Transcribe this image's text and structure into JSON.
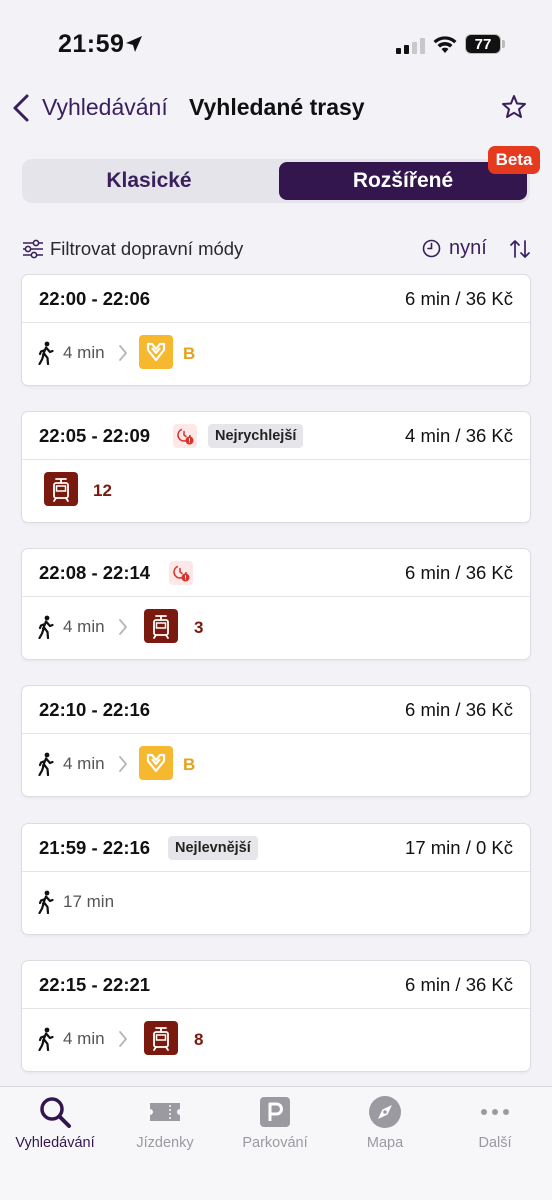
{
  "status_bar": {
    "time": "21:59",
    "battery": "77"
  },
  "nav": {
    "back_label": "Vyhledávání",
    "title": "Vyhledané trasy"
  },
  "segment": {
    "classic_label": "Klasické",
    "extended_label": "Rozšířené",
    "badge": "Beta",
    "selected": "extended"
  },
  "filter": {
    "label": "Filtrovat dopravní módy",
    "time_label": "nyní"
  },
  "routes": [
    {
      "time": "22:00 - 22:06",
      "info": "6 min / 36 Kč",
      "walk": "4 min",
      "line": "B",
      "mode": "metro"
    },
    {
      "time": "22:05 - 22:09",
      "info": "4 min / 36 Kč",
      "tag": "Nejrychlejší",
      "line": "12",
      "mode": "tram"
    },
    {
      "time": "22:08 - 22:14",
      "info": "6 min / 36 Kč",
      "walk": "4 min",
      "line": "3",
      "mode": "tram"
    },
    {
      "time": "22:10 - 22:16",
      "info": "6 min / 36 Kč",
      "walk": "4 min",
      "line": "B",
      "mode": "metro"
    },
    {
      "time": "21:59 - 22:16",
      "info": "17 min / 0 Kč",
      "tag": "Nejlevnější",
      "walk": "17 min"
    },
    {
      "time": "22:15 - 22:21",
      "info": "6 min / 36 Kč",
      "walk": "4 min",
      "line": "8",
      "mode": "tram"
    }
  ],
  "tabs": [
    {
      "label": "Vyhledávání",
      "icon": "search-icon",
      "active": true
    },
    {
      "label": "Jízdenky",
      "icon": "ticket-icon"
    },
    {
      "label": "Parkování",
      "icon": "parking-icon"
    },
    {
      "label": "Mapa",
      "icon": "compass-icon"
    },
    {
      "label": "Další",
      "icon": "more-icon"
    }
  ],
  "colors": {
    "accent": "#34164e",
    "metro_b": "#f5b82e",
    "tram": "#7a1a0f",
    "beta": "#e53a1e"
  }
}
